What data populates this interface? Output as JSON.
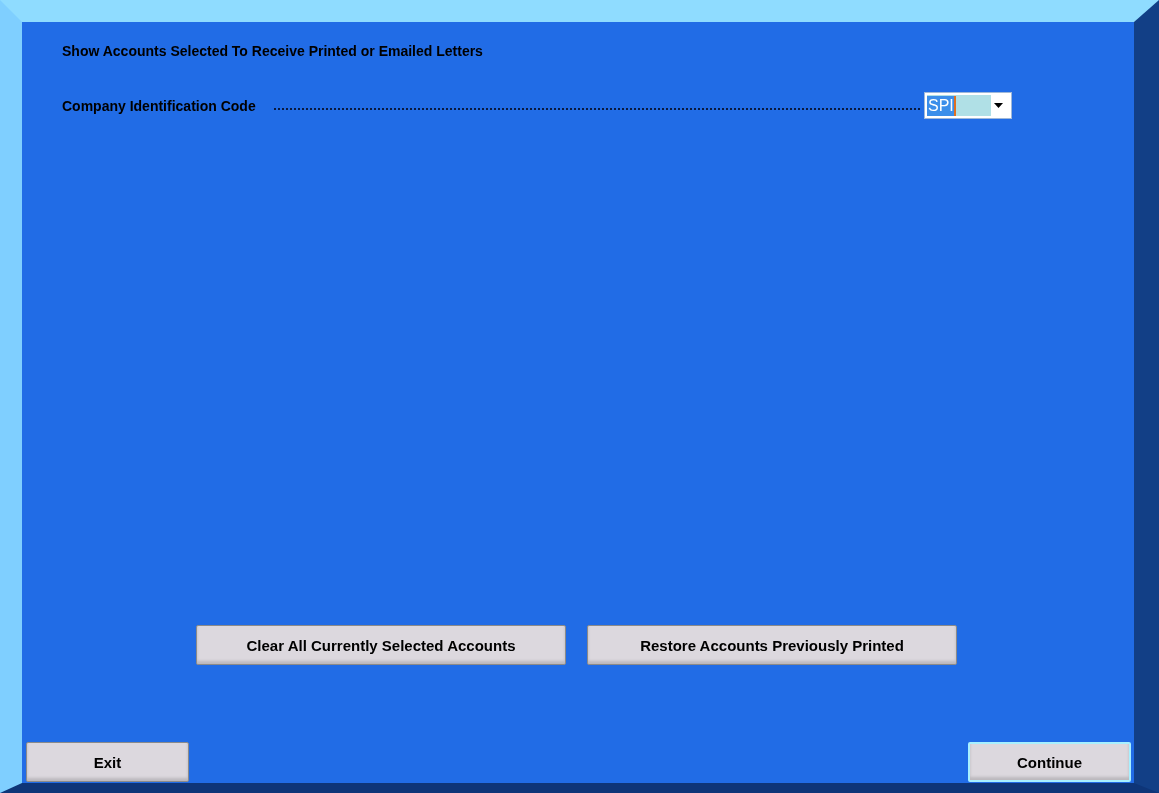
{
  "heading": "Show Accounts Selected To Receive Printed or Emailed Letters",
  "company_code": {
    "label": "Company Identification Code",
    "value": "SPI",
    "text_selected": true
  },
  "actions": [
    {
      "label": "Clear All Currently Selected Accounts"
    },
    {
      "label": "Restore Accounts Previously Printed"
    }
  ],
  "footer_buttons": [
    {
      "label": "Exit",
      "focused": false
    },
    {
      "label": "Continue",
      "focused": true
    }
  ]
}
